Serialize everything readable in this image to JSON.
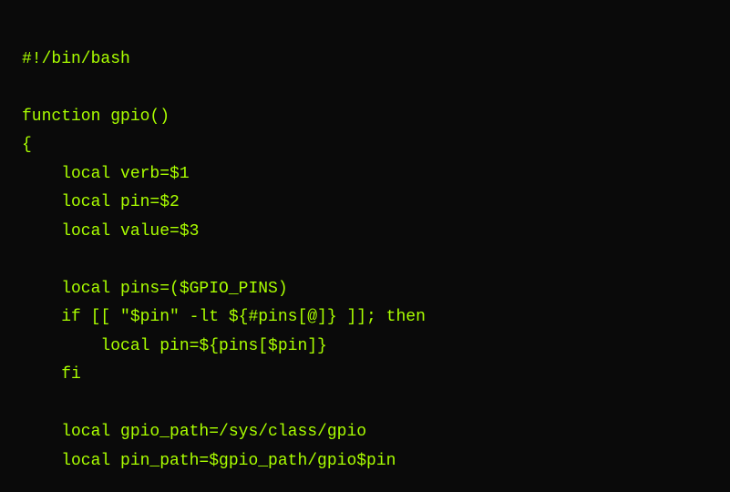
{
  "code": {
    "lines": [
      "#!/bin/bash",
      "",
      "function gpio()",
      "{",
      "    local verb=$1",
      "    local pin=$2",
      "    local value=$3",
      "",
      "    local pins=($GPIO_PINS)",
      "    if [[ \"$pin\" -lt ${#pins[@]} ]]; then",
      "        local pin=${pins[$pin]}",
      "    fi",
      "",
      "    local gpio_path=/sys/class/gpio",
      "    local pin_path=$gpio_path/gpio$pin"
    ]
  }
}
